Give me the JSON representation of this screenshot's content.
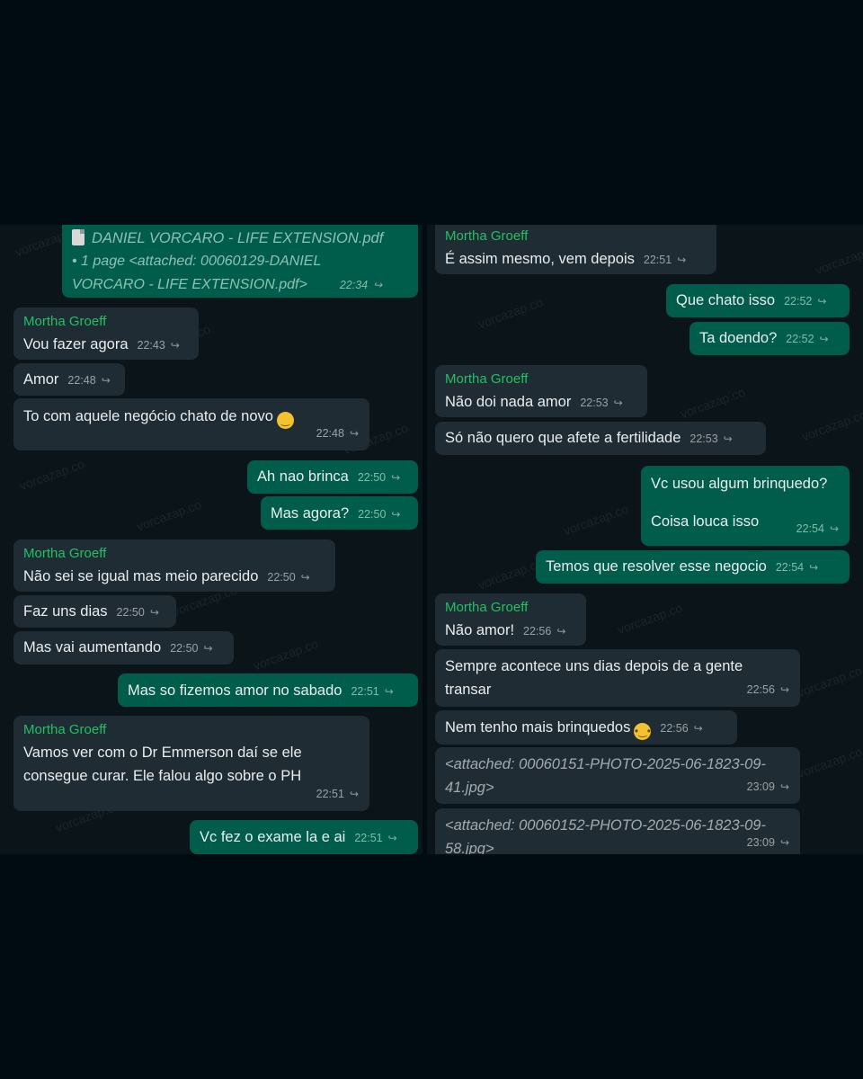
{
  "left": {
    "doc": {
      "title": "DANIEL VORCARO - LIFE EXTENSION.pdf",
      "line2": "• 1 page <attached: 00060129-DANIEL",
      "line3": "VORCARO - LIFE EXTENSION.pdf>",
      "time": "22:34"
    },
    "m1": {
      "sender": "Mortha Groeff",
      "text": "Vou fazer agora",
      "time": "22:43"
    },
    "m2": {
      "text": "Amor",
      "time": "22:48"
    },
    "m3": {
      "text": "To com aquele negócio chato de novo",
      "emoji": "crying-face-emoji",
      "time": "22:48"
    },
    "m4": {
      "text": "Ah nao brinca",
      "time": "22:50"
    },
    "m5": {
      "text": "Mas agora?",
      "time": "22:50"
    },
    "m6": {
      "sender": "Mortha Groeff",
      "text": "Não sei se igual mas meio parecido",
      "time": "22:50"
    },
    "m7": {
      "text": "Faz uns dias",
      "time": "22:50"
    },
    "m8": {
      "text": "Mas vai aumentando",
      "time": "22:50"
    },
    "m9": {
      "text": "Mas so fizemos amor no sabado",
      "time": "22:51"
    },
    "m10": {
      "sender": "Mortha Groeff",
      "line1": "Vamos ver com o Dr Emmerson daí se ele",
      "line2": "consegue curar. Ele falou algo sobre o PH",
      "time": "22:51"
    },
    "m11": {
      "text": "Vc fez o exame la e ai",
      "time": "22:51"
    }
  },
  "right": {
    "m1": {
      "sender": "Mortha Groeff",
      "text": "É assim mesmo, vem depois",
      "time": "22:51"
    },
    "m2": {
      "text": "Que chato isso",
      "time": "22:52"
    },
    "m3": {
      "text": "Ta doendo?",
      "time": "22:52"
    },
    "m4": {
      "sender": "Mortha Groeff",
      "text": "Não doi nada amor",
      "time": "22:53"
    },
    "m5": {
      "text": "Só não quero que afete a fertilidade",
      "time": "22:53"
    },
    "m6": {
      "line1": "Vc usou algum brinquedo?",
      "line2": "Coisa louca isso",
      "time": "22:54"
    },
    "m7": {
      "text": "Temos que resolver esse negocio",
      "time": "22:54"
    },
    "m8": {
      "sender": "Mortha Groeff",
      "text": "Não amor!",
      "time": "22:56"
    },
    "m9": {
      "line1": "Sempre acontece uns dias depois de a gente",
      "line2": "transar",
      "time": "22:56"
    },
    "m10": {
      "text": "Nem tenho mais brinquedos",
      "emoji": "pleading-face-emoji",
      "time": "22:56"
    },
    "m11": {
      "line1": "<attached: 00060151-PHOTO-2025-06-1823-09-",
      "line2": "41.jpg>",
      "time": "23:09"
    },
    "m12": {
      "line1": "<attached: 00060152-PHOTO-2025-06-1823-09-",
      "line2": "58.jpg>",
      "time": "23:09"
    }
  },
  "watermark": "vorcazap.co",
  "forward_icon": "forward-arrow-icon",
  "colors": {
    "incoming": "#1f2c33",
    "outgoing": "#005c4b",
    "sender": "#21c063",
    "background": "#0a1419"
  }
}
